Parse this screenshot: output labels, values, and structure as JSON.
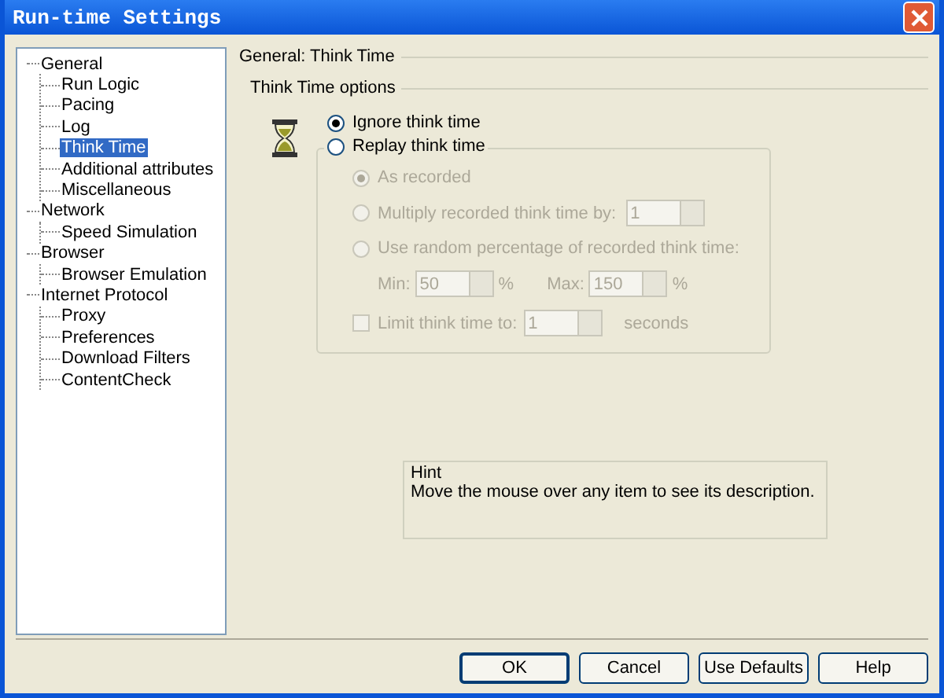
{
  "window": {
    "title": "Run-time Settings"
  },
  "tree": [
    {
      "label": "General",
      "selected": false,
      "children": [
        {
          "label": "Run Logic",
          "selected": false
        },
        {
          "label": "Pacing",
          "selected": false
        },
        {
          "label": "Log",
          "selected": false
        },
        {
          "label": "Think Time",
          "selected": true
        },
        {
          "label": "Additional attributes",
          "selected": false
        },
        {
          "label": "Miscellaneous",
          "selected": false
        }
      ]
    },
    {
      "label": "Network",
      "selected": false,
      "children": [
        {
          "label": "Speed Simulation",
          "selected": false
        }
      ]
    },
    {
      "label": "Browser",
      "selected": false,
      "children": [
        {
          "label": "Browser Emulation",
          "selected": false
        }
      ]
    },
    {
      "label": "Internet Protocol",
      "selected": false,
      "children": [
        {
          "label": "Proxy",
          "selected": false
        },
        {
          "label": "Preferences",
          "selected": false
        },
        {
          "label": "Download Filters",
          "selected": false
        },
        {
          "label": "ContentCheck",
          "selected": false
        }
      ]
    }
  ],
  "panel_title": "General: Think Time",
  "options_title": "Think Time options",
  "ignore": {
    "label": "Ignore think time",
    "selected": true
  },
  "replay": {
    "label": "Replay think time",
    "selected": false,
    "disabled": true,
    "choices": [
      {
        "kind": "plain",
        "label": "As recorded",
        "selected": true
      },
      {
        "kind": "spin",
        "label": "Multiply recorded think time by:",
        "selected": false,
        "value": "1"
      },
      {
        "kind": "range",
        "label": "Use random percentage of recorded think time:",
        "selected": false,
        "min_label": "Min:",
        "min": "50",
        "max_label": "Max:",
        "max": "150",
        "unit": "%"
      }
    ],
    "limit": {
      "label": "Limit think time to:",
      "checked": false,
      "value": "1",
      "unit": "seconds"
    }
  },
  "hint": {
    "title": "Hint",
    "text": "Move the mouse over any item to see its description."
  },
  "buttons": [
    "OK",
    "Cancel",
    "Use Defaults",
    "Help"
  ]
}
